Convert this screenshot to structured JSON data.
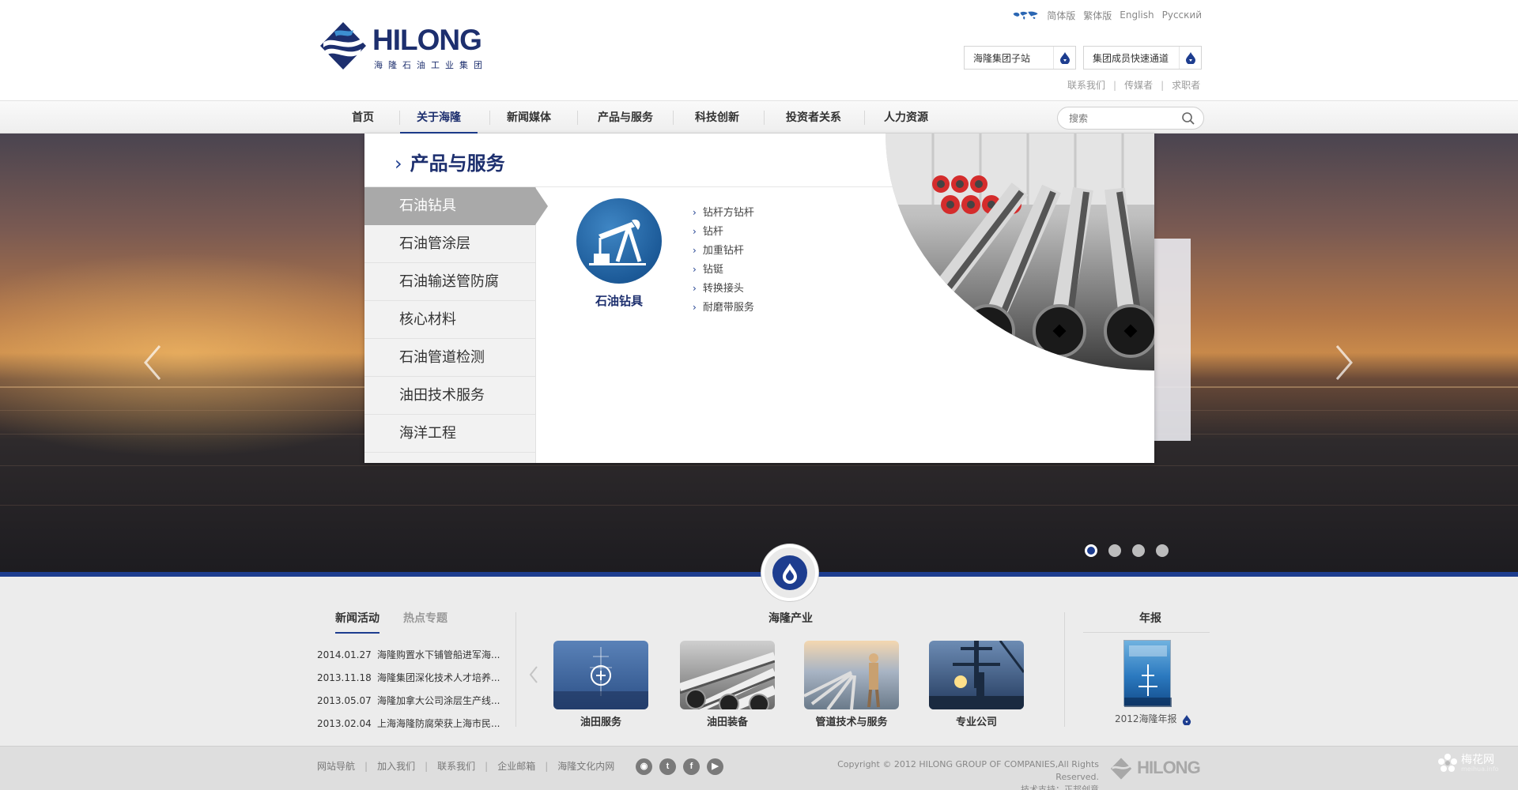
{
  "header": {
    "brand": "HILONG",
    "brand_sub": "海隆石油工业集团",
    "languages": [
      "简体版",
      "繁体版",
      "English",
      "Русский"
    ],
    "quick_select_1": "海隆集团子站",
    "quick_select_2": "集团成员快速通道",
    "top_links": [
      "联系我们",
      "传媒者",
      "求职者"
    ]
  },
  "nav": {
    "items": [
      {
        "label": "首页"
      },
      {
        "label": "关于海隆",
        "active": true
      },
      {
        "label": "新闻媒体"
      },
      {
        "label": "产品与服务"
      },
      {
        "label": "科技创新"
      },
      {
        "label": "投资者关系"
      },
      {
        "label": "人力资源"
      }
    ],
    "search_placeholder": "搜索"
  },
  "mega_menu": {
    "title": "产品与服务",
    "categories": [
      {
        "label": "石油钻具",
        "active": true
      },
      {
        "label": "石油管涂层"
      },
      {
        "label": "石油输送管防腐"
      },
      {
        "label": "核心材料"
      },
      {
        "label": "石油管道检测"
      },
      {
        "label": "油田技术服务"
      },
      {
        "label": "海洋工程"
      }
    ],
    "product_name": "石油钻具",
    "sub_items": [
      "钻杆方钻杆",
      "钻杆",
      "加重钻杆",
      "钻铤",
      "转换接头",
      "耐磨带服务"
    ]
  },
  "banner": {
    "slide_count": 4,
    "active_slide": 1
  },
  "news": {
    "tabs": [
      {
        "label": "新闻活动",
        "active": true
      },
      {
        "label": "热点专题"
      }
    ],
    "items": [
      {
        "date": "2014.01.27",
        "title": "海隆购置水下铺管船进军海..."
      },
      {
        "date": "2013.11.18",
        "title": "海隆集团深化技术人才培养..."
      },
      {
        "date": "2013.05.07",
        "title": "海隆加拿大公司涂层生产线..."
      },
      {
        "date": "2013.02.04",
        "title": "上海海隆防腐荣获上海市民..."
      }
    ]
  },
  "industry": {
    "title": "海隆产业",
    "items": [
      {
        "label": "油田服务"
      },
      {
        "label": "油田装备"
      },
      {
        "label": "管道技术与服务"
      },
      {
        "label": "专业公司"
      }
    ]
  },
  "annual": {
    "title": "年报",
    "label": "2012海隆年报"
  },
  "footer": {
    "links": [
      "网站导航",
      "加入我们",
      "联系我们",
      "企业邮箱",
      "海隆文化内网"
    ],
    "copyright_1": "Copyright © 2012 HILONG GROUP OF COMPANIES,All Rights Reserved.",
    "copyright_2": "技术支持：正邦创意",
    "logo": "HILONG"
  },
  "watermark": {
    "title": "梅花网",
    "url": "meihua.info"
  },
  "colors": {
    "brand_navy": "#1d2f6e",
    "accent_blue": "#1d3d8f",
    "menu_active_gray": "#a9a9a9"
  }
}
